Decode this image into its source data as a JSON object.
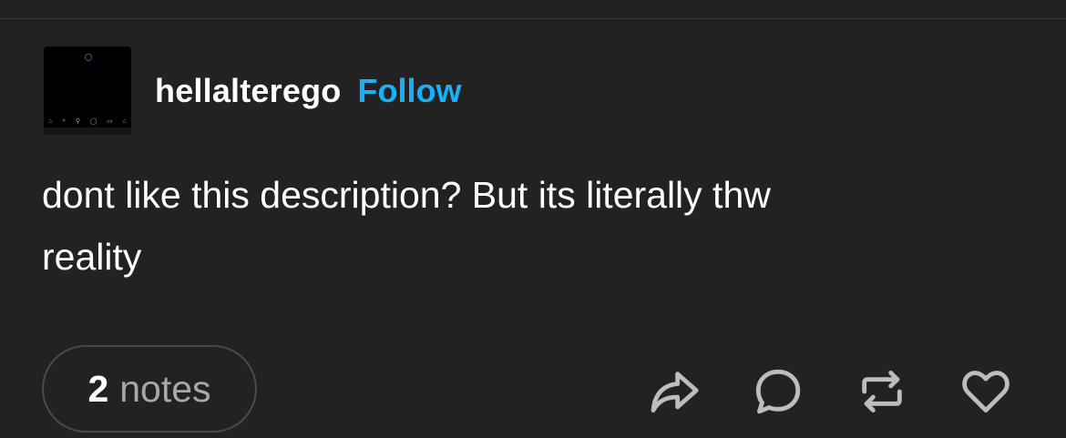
{
  "post": {
    "username": "hellalterego",
    "follow_label": "Follow",
    "text_line1": "dont like this description? But its literally thw",
    "text_line2": "reality",
    "notes_count": "2",
    "notes_label": "notes"
  },
  "actions": [
    "share-icon",
    "reply-icon",
    "reblog-icon",
    "like-icon"
  ],
  "colors": {
    "background": "#222222",
    "follow": "#1ab0f5",
    "icon": "#bdbdbd"
  }
}
